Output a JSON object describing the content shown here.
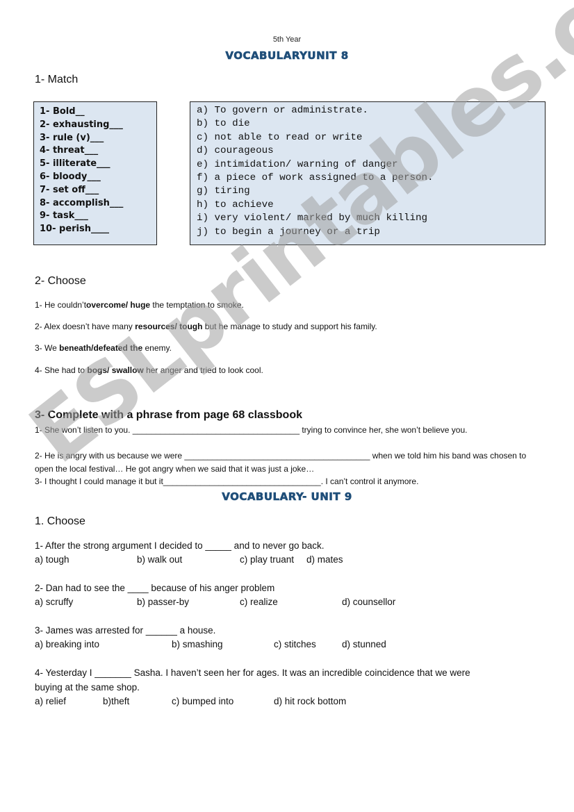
{
  "header": {
    "subtitle": "5th Year",
    "title": "VOCABULARYUNIT 8"
  },
  "section1": {
    "heading": "1- Match",
    "words": [
      "1- Bold__",
      "2- exhausting___",
      "3- rule (v)___",
      "4- threat___",
      "5- illiterate___",
      "6- bloody___",
      "7- set off___",
      "8- accomplish___",
      "9- task___",
      "10- perish____"
    ],
    "definitions": [
      "a) To govern or administrate.",
      "b) to die",
      "c) not able to read or write",
      "d) courageous",
      "e) intimidation/ warning of danger",
      "f) a piece of work assigned to a person.",
      "g) tiring",
      "h) to achieve",
      "i) very violent/ marked by much killing",
      "j) to begin a journey or a trip"
    ]
  },
  "section2": {
    "heading": "2- Choose",
    "sentences": [
      {
        "pre": "1- He couldn’t",
        "bold": "overcome/ huge",
        "post": " the temptation to smoke."
      },
      {
        "pre": "2- Alex doesn’t have many ",
        "bold": "resources/ tough",
        "post": " but he manage to study and support his family."
      },
      {
        "pre": "3- We ",
        "bold": "beneath/defeated the",
        "post": " enemy."
      },
      {
        "pre": "4- She had to ",
        "bold": "bogs/ swallow",
        "post": " her anger and tried to look cool."
      }
    ]
  },
  "section3": {
    "heading": "3- Complete with a phrase from page 68 classbook",
    "items": [
      "1- She won’t listen to you. ____________________________________ trying to convince her, she won’t believe you.",
      "2- He is angry with us because we were ________________________________________ when we told him his band was chosen to open the local festival… He got angry when we said that it was just a joke…",
      "3- I thought I could manage it but it__________________________________. I can’t control it anymore."
    ]
  },
  "unit9": {
    "title": "VOCABULARY- UNIT 9",
    "heading": "1. Choose",
    "questions": [
      {
        "text": "1- After the strong argument I decided to _____ and to never go back.",
        "options": [
          "a) tough",
          "b) walk out",
          "c) play truant",
          "d) mates"
        ]
      },
      {
        "text": "2-  Dan had to see the ____ because of his anger problem",
        "options": [
          "a) scruffy",
          "b) passer-by",
          "c) realize",
          "d) counsellor"
        ]
      },
      {
        "text": "3- James was arrested for ______ a house.",
        "options": [
          "a) breaking into",
          "b) smashing",
          "c) stitches",
          "d) stunned"
        ]
      },
      {
        "text": "4- Yesterday I _______ Sasha. I haven’t seen her for ages. It was an incredible coincidence that we were",
        "text2": "buying at the same shop.",
        "options": [
          "a) relief",
          "b)theft",
          "c) bumped into",
          "d) hit rock bottom"
        ]
      }
    ]
  },
  "watermark": "ESLprintables.com"
}
